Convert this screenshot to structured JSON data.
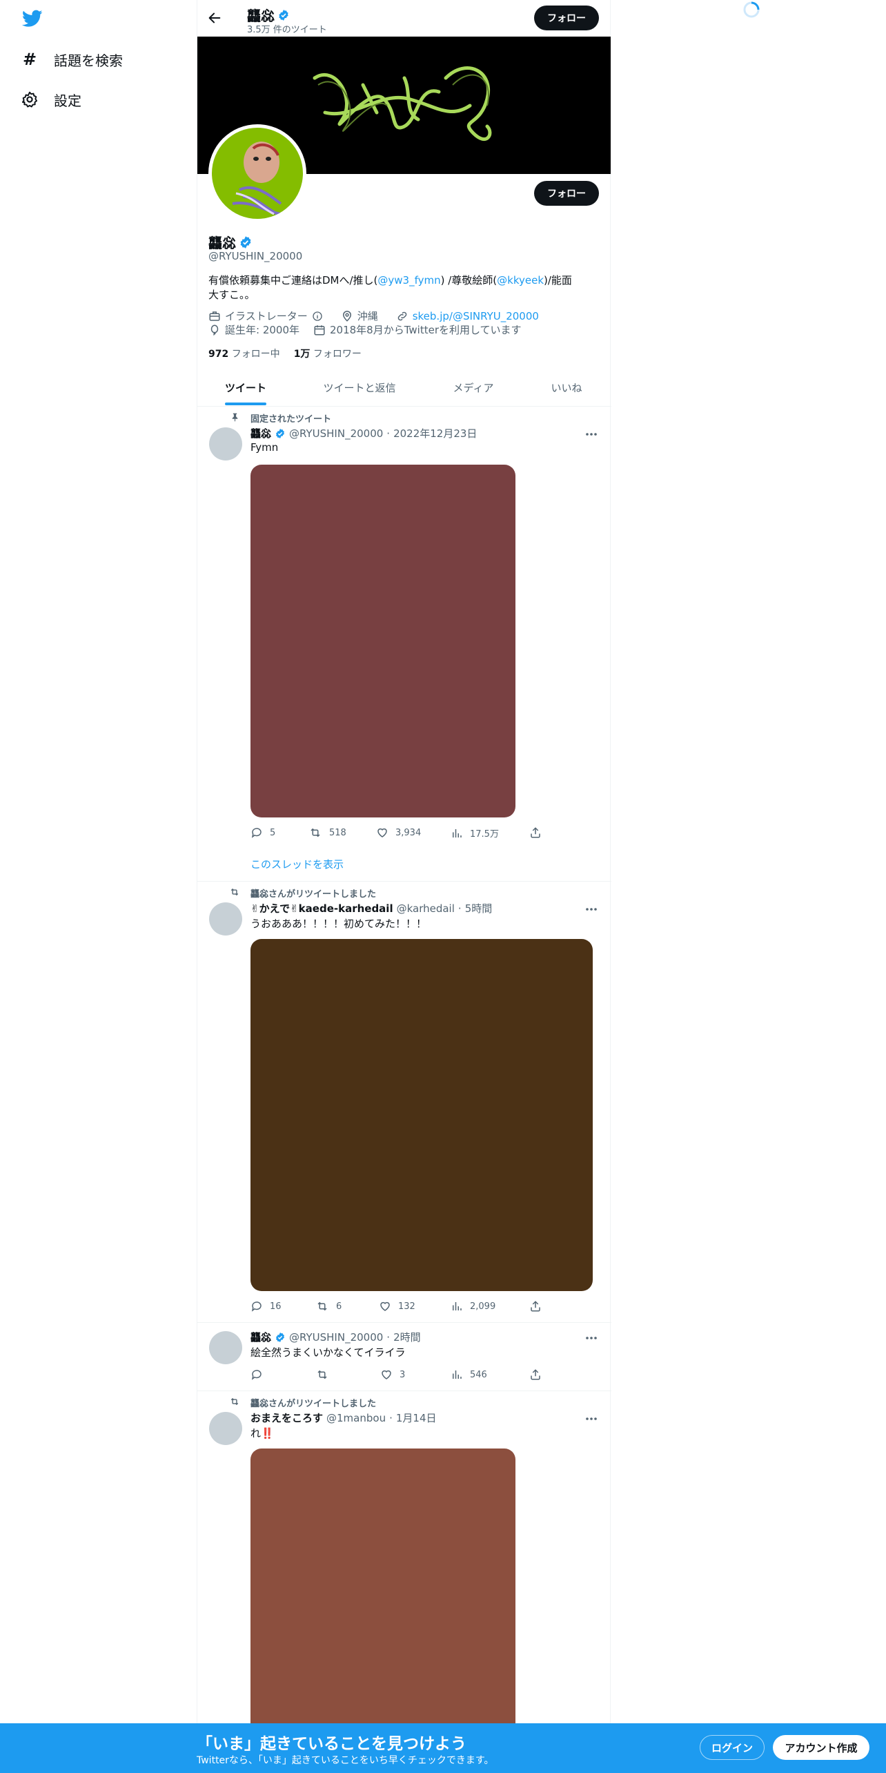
{
  "sidebar": {
    "explore_label": "話題を検索",
    "settings_label": "設定"
  },
  "header": {
    "name": "龘惢",
    "tweet_count": "3.5万 件のツイート",
    "follow_label": "フォロー"
  },
  "profile": {
    "name": "龘惢",
    "handle": "@RYUSHIN_20000",
    "bio_1": "有償依頼募集中ご連絡はDMへ/推し(",
    "bio_mention1": "@yw3_fymn",
    "bio_2": ") /尊敬絵師(",
    "bio_mention2": "@kkyeek",
    "bio_3": ")/能面大すこ。。",
    "category": "イラストレーター",
    "location": "沖縄",
    "url": "skeb.jp/@SINRYU_20000",
    "birth": "誕生年: 2000年",
    "joined": "2018年8月からTwitterを利用しています",
    "following_count": "972",
    "following_label": "フォロー中",
    "followers_count": "1万",
    "followers_label": "フォロワー",
    "follow_label": "フォロー"
  },
  "tabs": [
    "ツイート",
    "ツイートと返信",
    "メディア",
    "いいね"
  ],
  "tweets": [
    {
      "context": "固定されたツイート",
      "name": "龘惢",
      "handle": "@RYUSHIN_20000",
      "time": "2022年12月23日",
      "text": "Fymn",
      "media_color": "#784041",
      "replies": "5",
      "retweets": "518",
      "likes": "3,934",
      "views": "17.5万",
      "show_thread": "このスレッドを表示"
    },
    {
      "context": "龘惢さんがリツイートしました",
      "name": "✌かえで✌kaede-karhedail",
      "handle": "@karhedail",
      "time": "5時間",
      "text": "うおあああ！！！！初めてみた！！！",
      "media_color": "#4b3115",
      "replies": "16",
      "retweets": "6",
      "likes": "132",
      "views": "2,099"
    },
    {
      "name": "龘惢",
      "handle": "@RYUSHIN_20000",
      "time": "2時間",
      "text": "絵全然うまくいかなくてイライラ",
      "replies": "",
      "retweets": "",
      "likes": "3",
      "views": "546"
    },
    {
      "context": "龘惢さんがリツイートしました",
      "name": "おまえをころす",
      "handle": "@1manbou",
      "time": "1月14日",
      "text": "れ‼️",
      "media_color": "#8c4f3e"
    }
  ],
  "bottom_bar": {
    "title": "「いま」起きていることを見つけよう",
    "subtitle": "Twitterなら、「いま」起きていることをいち早くチェックできます。",
    "login_label": "ログイン",
    "signup_label": "アカウント作成"
  },
  "colors": {
    "accent": "#1d9bf0",
    "dark": "#0f1419",
    "muted": "#536471"
  }
}
